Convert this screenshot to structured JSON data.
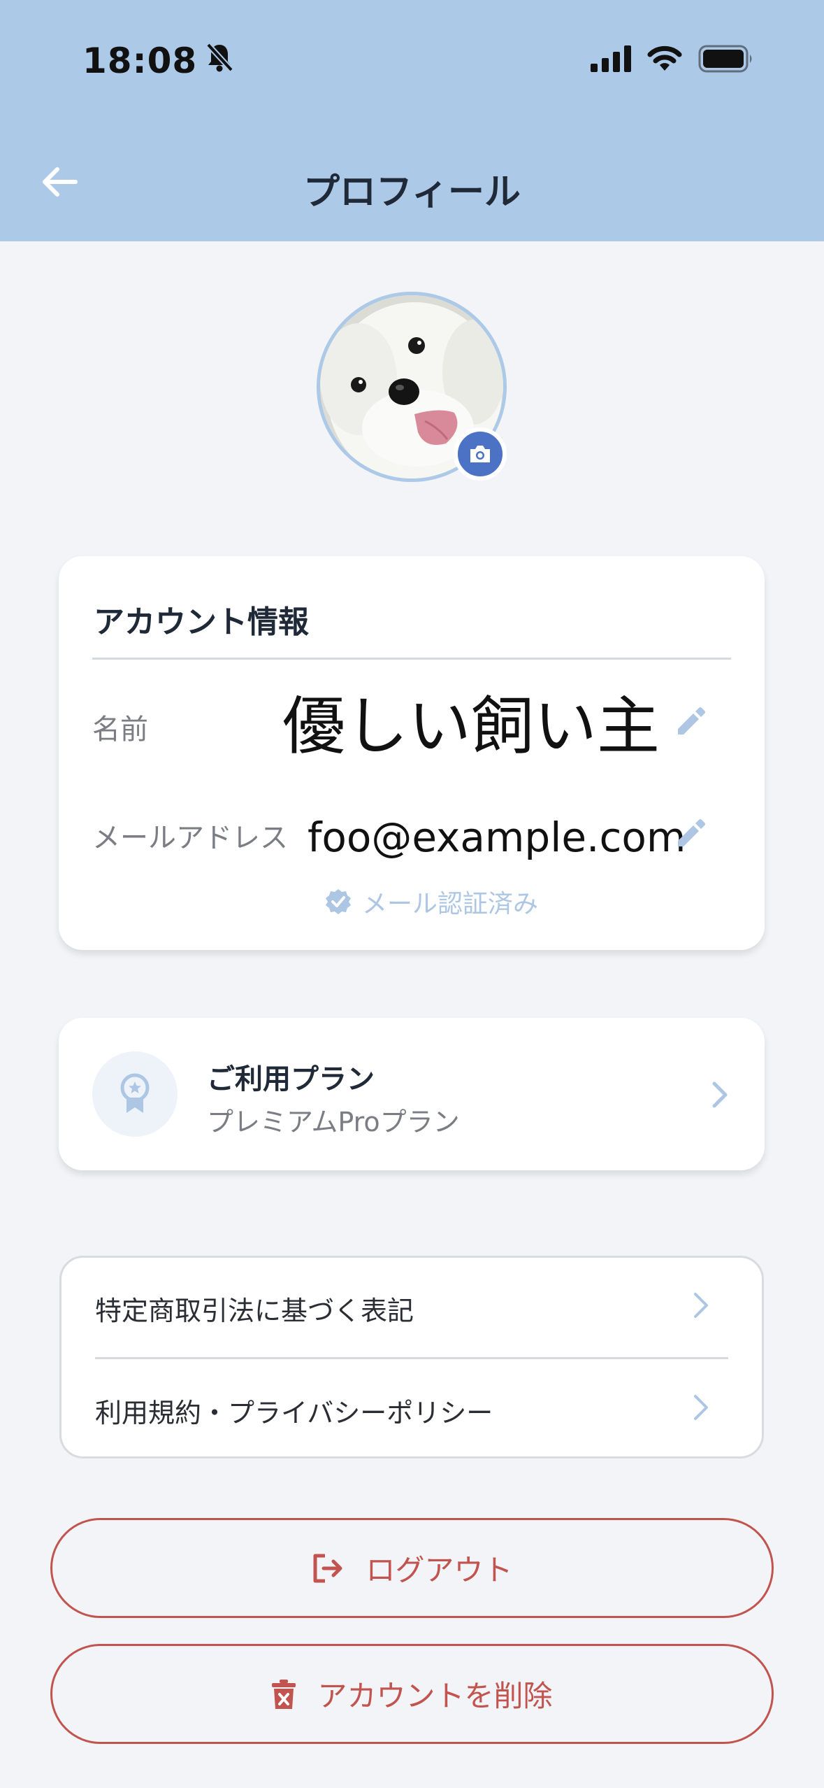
{
  "status_bar": {
    "time": "18:08"
  },
  "header": {
    "title": "プロフィール"
  },
  "account": {
    "title": "アカウント情報",
    "name_label": "名前",
    "name_value": "優しい飼い主",
    "email_label": "メールアドレス",
    "email_value": "foo@example.com",
    "verified_text": "メール認証済み"
  },
  "plan": {
    "title": "ご利用プラン",
    "name": "プレミアムProプラン"
  },
  "legal": {
    "items": [
      {
        "label": "特定商取引法に基づく表記"
      },
      {
        "label": "利用規約・プライバシーポリシー"
      }
    ]
  },
  "actions": {
    "logout": "ログアウト",
    "delete_account": "アカウントを削除"
  },
  "colors": {
    "header_bg": "#adc9e8",
    "accent": "#4b72c4",
    "danger": "#c2544f",
    "page_bg": "#f2f4f8"
  }
}
